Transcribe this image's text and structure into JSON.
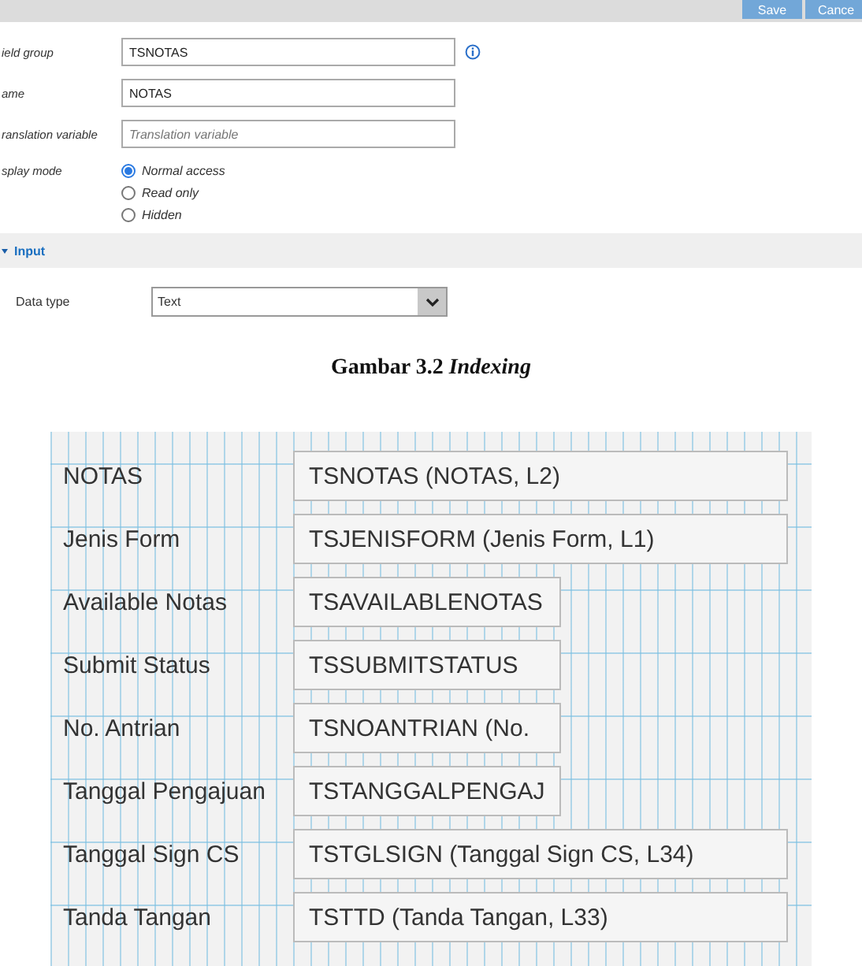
{
  "form": {
    "header_buttons": [
      {
        "label": "Save"
      },
      {
        "label": "Cance"
      }
    ],
    "fields": [
      {
        "label": "ield group",
        "value": "TSNOTAS",
        "info": true
      },
      {
        "label": "ame",
        "value": "NOTAS",
        "info": false
      },
      {
        "label": "ranslation variable",
        "placeholder": "Translation variable",
        "info": false
      }
    ],
    "display_mode": {
      "label": "splay mode",
      "options": [
        {
          "label": "Normal access",
          "selected": true
        },
        {
          "label": "Read only",
          "selected": false
        },
        {
          "label": "Hidden",
          "selected": false
        }
      ]
    },
    "section": {
      "title": "Input",
      "expanded": true
    },
    "data_type": {
      "label": "Data type",
      "value": "Text"
    }
  },
  "caption": "Gambar 3.2 *Indexing*",
  "mapping": {
    "rows": [
      {
        "label": "NOTAS",
        "value": "TSNOTAS (NOTAS, L2)",
        "kind": "wide"
      },
      {
        "label": "Jenis Form",
        "value": "TSJENISFORM (Jenis Form, L1)",
        "kind": "wide"
      },
      {
        "label": "Available Notas",
        "value": "TSAVAILABLENOTAS",
        "kind": "narrow"
      },
      {
        "label": "Submit Status",
        "value": "TSSUBMITSTATUS",
        "kind": "narrow"
      },
      {
        "label": "No. Antrian",
        "value": "TSNOANTRIAN (No.",
        "kind": "narrow"
      },
      {
        "label": "Tanggal Pengajuan",
        "value": "TSTANGGALPENGAJ",
        "kind": "narrow"
      },
      {
        "label": "Tanggal Sign CS",
        "value": "TSTGLSIGN (Tanggal Sign CS, L34)",
        "kind": "wide"
      },
      {
        "label": "Tanda Tangan",
        "value": "TSTTD (Tanda Tangan, L33)",
        "kind": "wide"
      }
    ]
  }
}
